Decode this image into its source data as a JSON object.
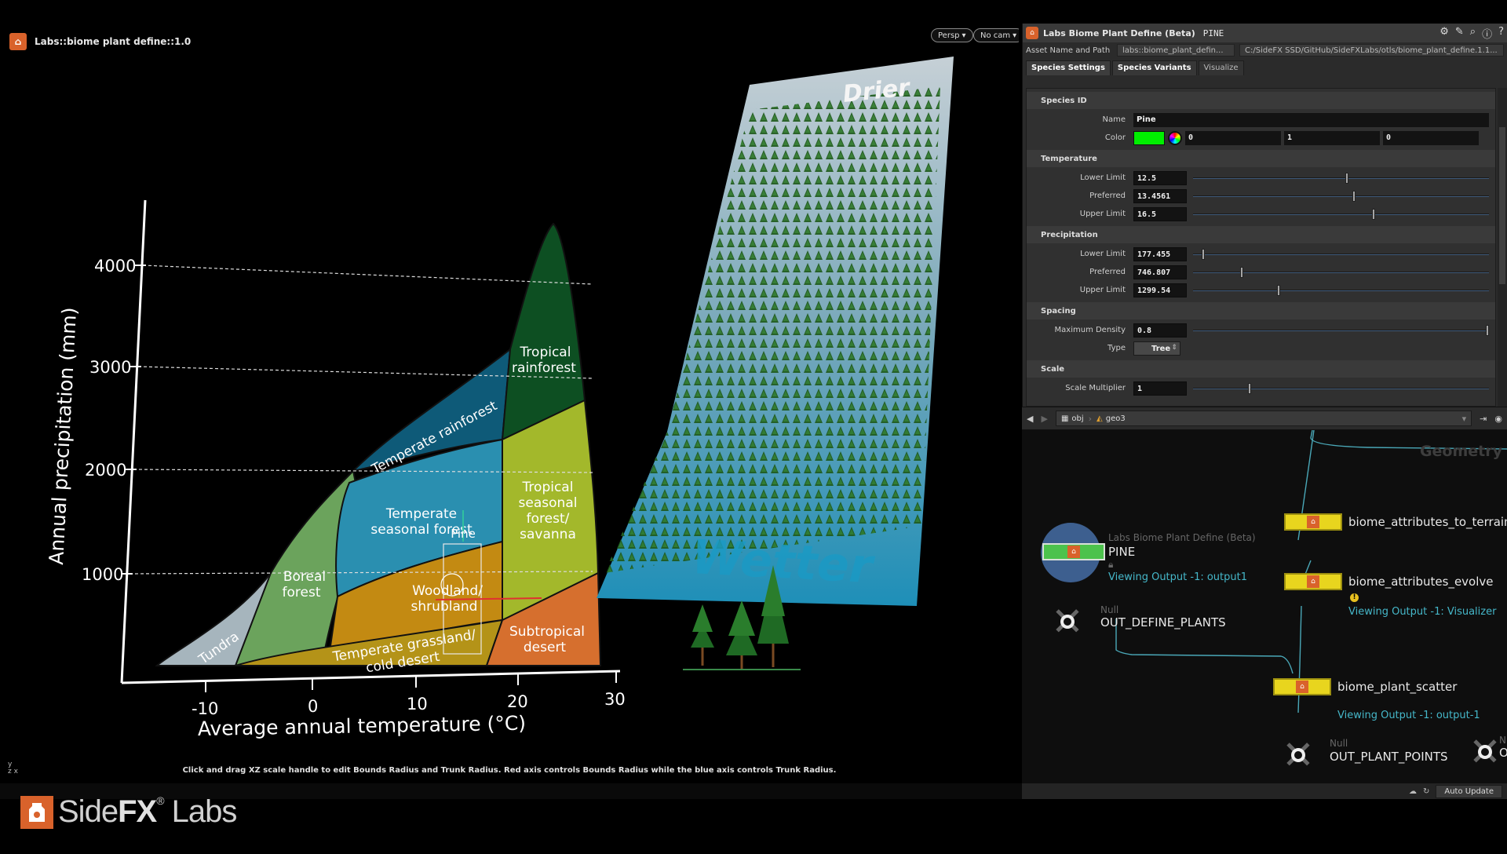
{
  "viewport": {
    "title": "Labs::biome plant define::1.0",
    "persp_label": "Persp",
    "cam_label": "No cam",
    "status_message": "Click and drag XZ scale handle to edit Bounds Radius and Trunk Radius. Red axis controls Bounds Radius while the blue axis controls Trunk Radius.",
    "gizmo_label": "y\nz x",
    "label_drier": "Drier",
    "label_wetter": "Wetter",
    "handle_label": "Pine"
  },
  "chart_data": {
    "type": "diagram",
    "ylabel": "Annual precipitation (mm)",
    "xlabel": "Average annual temperature (°C)",
    "x_ticks": [
      "-10",
      "0",
      "10",
      "20",
      "30"
    ],
    "y_ticks": [
      "1000",
      "2000",
      "3000",
      "4000"
    ],
    "biomes": [
      {
        "name": "Tundra",
        "color": "#a6b5bd"
      },
      {
        "name": "Boreal forest",
        "color": "#6ba35c"
      },
      {
        "name": "Temperate seasonal forest",
        "color": "#2a8fb0"
      },
      {
        "name": "Temperate rainforest",
        "color": "#0e5a78"
      },
      {
        "name": "Tropical rainforest",
        "color": "#0d4f22"
      },
      {
        "name": "Tropical seasonal forest/ savanna",
        "color": "#a3b82b"
      },
      {
        "name": "Woodland/ shrubland",
        "color": "#c38a12"
      },
      {
        "name": "Temperate grassland/ cold desert",
        "color": "#b49318"
      },
      {
        "name": "Subtropical desert",
        "color": "#d66f2e"
      }
    ]
  },
  "params": {
    "header_title": "Labs Biome Plant Define (Beta)",
    "node_name": "PINE",
    "asset_label": "Asset Name and Path",
    "asset_name": "labs::biome_plant_defin...",
    "asset_path": "C:/SideFX SSD/GitHub/SideFXLabs/otls/biome_plant_define.1.1...",
    "tabs": [
      "Species Settings",
      "Species Variants",
      "Visualize"
    ],
    "sections": {
      "species_id": "Species ID",
      "temperature": "Temperature",
      "precipitation": "Precipitation",
      "spacing": "Spacing",
      "scale": "Scale"
    },
    "name_label": "Name",
    "name_value": "Pine",
    "color_label": "Color",
    "color_r": "0",
    "color_g": "1",
    "color_b": "0",
    "color_hex": "#00ee00",
    "temp": [
      {
        "label": "Lower Limit",
        "value": "12.5",
        "fraction": 0.52
      },
      {
        "label": "Preferred",
        "value": "13.4561",
        "fraction": 0.545
      },
      {
        "label": "Upper Limit",
        "value": "16.5",
        "fraction": 0.61
      }
    ],
    "precip": [
      {
        "label": "Lower Limit",
        "value": "177.455",
        "fraction": 0.035
      },
      {
        "label": "Preferred",
        "value": "746.807",
        "fraction": 0.165
      },
      {
        "label": "Upper Limit",
        "value": "1299.54",
        "fraction": 0.29
      }
    ],
    "density_label": "Maximum Density",
    "density_value": "0.8",
    "density_fraction": 0.995,
    "type_label": "Type",
    "type_value": "Tree",
    "scale_mult_label": "Scale Multiplier",
    "scale_mult_value": "1",
    "scale_mult_fraction": 0.19
  },
  "pathbar": {
    "obj": "obj",
    "geo": "geo3"
  },
  "network": {
    "context": "Geometry",
    "define_type": "Labs Biome Plant Define (Beta)",
    "define_name": "PINE",
    "define_output": "Viewing Output -1: output1",
    "null1_type": "Null",
    "null1_name": "OUT_DEFINE_PLANTS",
    "attr_terrain": "biome_attributes_to_terrain",
    "attr_evolve": "biome_attributes_evolve",
    "evolve_output": "Viewing Output -1: Visualizer",
    "scatter": "biome_plant_scatter",
    "scatter_output": "Viewing Output -1: output-1",
    "null2_type": "Null",
    "null2_name": "OUT_PLANT_POINTS",
    "null3_type": "N",
    "null3_name": "O"
  },
  "statusbar": {
    "auto_update": "Auto Update"
  },
  "watermark": {
    "side": "Side",
    "fx": "FX",
    "labs": "Labs",
    "reg": "®"
  }
}
